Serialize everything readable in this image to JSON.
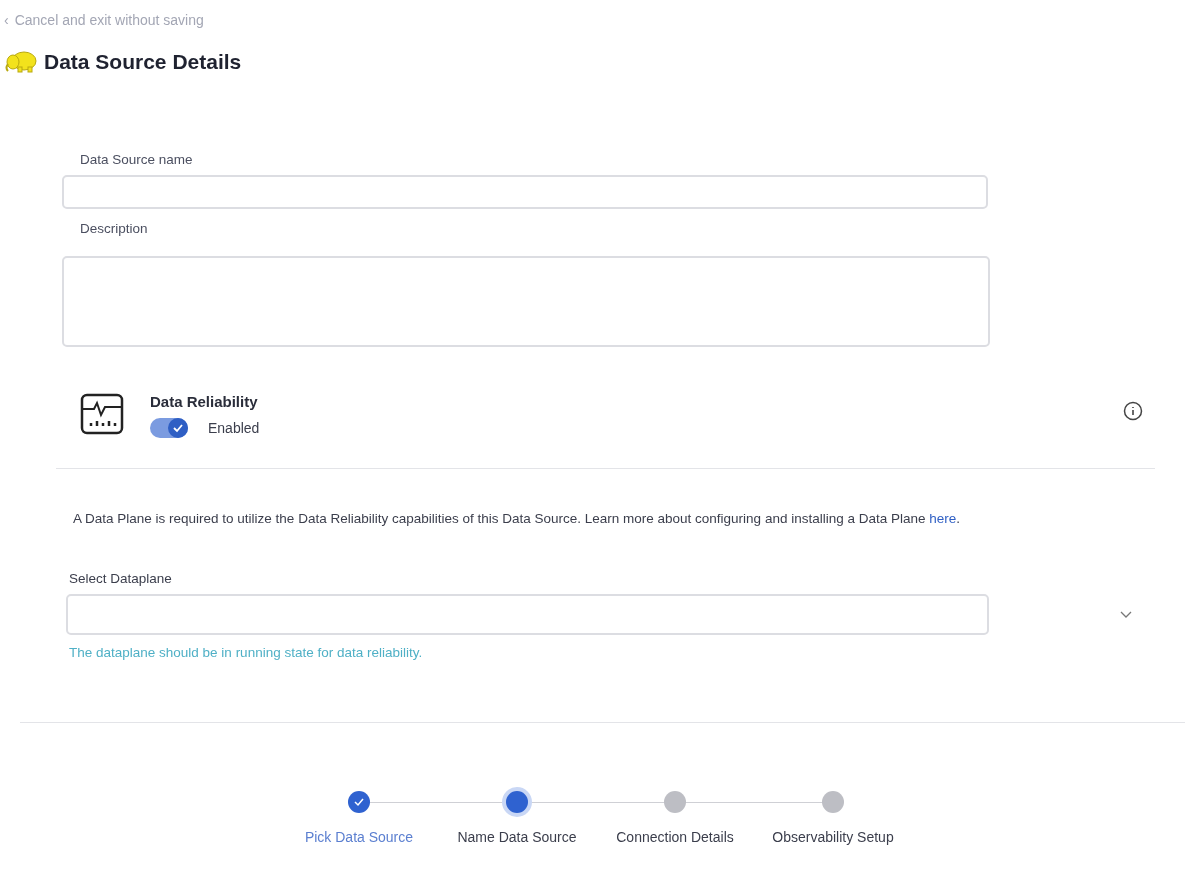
{
  "back_link": {
    "icon": "‹",
    "label": "Cancel and exit without saving"
  },
  "page_title": "Data Source Details",
  "form": {
    "name_label": "Data Source name",
    "description_label": "Description"
  },
  "reliability": {
    "title": "Data Reliability",
    "enabled": true,
    "toggle_label": "Enabled"
  },
  "dataplane_notice": {
    "text": "A Data Plane is required to utilize the Data Reliability capabilities of this Data Source. Learn more about configuring and installing a Data Plane ",
    "link": "here",
    "end": "."
  },
  "dataplane_select": {
    "label": "Select Dataplane",
    "hint": "The dataplane should be in running state for data reliability."
  },
  "steps": [
    {
      "label": "Pick Data Source",
      "completed": true,
      "selected": false
    },
    {
      "label": "Name Data Source",
      "completed": false,
      "selected": true
    },
    {
      "label": "Connection Details",
      "completed": false,
      "selected": false
    },
    {
      "label": "Observability Setup",
      "completed": false,
      "selected": false
    }
  ]
}
